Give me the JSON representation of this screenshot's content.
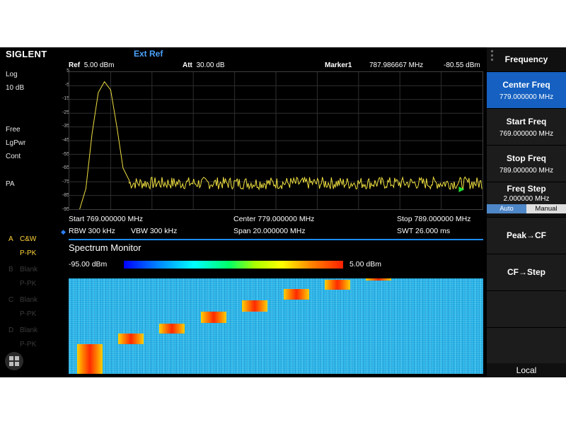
{
  "top": {
    "brand": "SIGLENT",
    "ext_ref": "Ext Ref"
  },
  "header": {
    "ref_label": "Ref",
    "ref_value": "5.00 dBm",
    "att_label": "Att",
    "att_value": "30.00 dB",
    "marker_label": "Marker1",
    "marker_freq": "787.986667 MHz",
    "marker_level": "-80.55 dBm"
  },
  "left_panel": {
    "scale_type": "Log",
    "scale_div": "10 dB",
    "trigger": "Free",
    "avg_type": "LgPwr",
    "sweep_mode": "Cont",
    "preamp": "PA",
    "traces": [
      {
        "letter": "A",
        "mode": "C&W",
        "detector": "P-PK",
        "active": true
      },
      {
        "letter": "B",
        "mode": "Blank",
        "detector": "P-PK",
        "active": false
      },
      {
        "letter": "C",
        "mode": "Blank",
        "detector": "P-PK",
        "active": false
      },
      {
        "letter": "D",
        "mode": "Blank",
        "detector": "P-PK",
        "active": false
      }
    ]
  },
  "yticks": [
    "5",
    "-5",
    "-15",
    "-25",
    "-35",
    "-45",
    "-55",
    "-65",
    "-75",
    "-85",
    "-95"
  ],
  "info": {
    "start": "Start  769.000000 MHz",
    "center": "Center  779.000000 MHz",
    "stop": "Stop  789.000000 MHz",
    "rbw": "RBW  300 kHz",
    "vbw": "VBW  300 kHz",
    "span": "Span    20.000000 MHz",
    "swt": "SWT  26.000 ms"
  },
  "spectrum_monitor": {
    "title": "Spectrum Monitor",
    "scale_min": "-95.00 dBm",
    "scale_max": "5.00 dBm"
  },
  "menu": {
    "title": "Frequency",
    "buttons": [
      {
        "label": "Center Freq",
        "value": "779.000000 MHz",
        "active": true
      },
      {
        "label": "Start Freq",
        "value": "769.000000 MHz",
        "active": false
      },
      {
        "label": "Stop Freq",
        "value": "789.000000 MHz",
        "active": false
      },
      {
        "label": "Freq Step",
        "value": "2.000000 MHz",
        "active": false
      },
      {
        "label": "Peak→CF",
        "value": "",
        "active": false
      },
      {
        "label": "CF→Step",
        "value": "",
        "active": false
      }
    ],
    "step_mode": {
      "auto": "Auto",
      "manual": "Manual",
      "selected": "Auto"
    },
    "local": "Local"
  },
  "colors": {
    "trace": "#f0e040",
    "marker": "#22dd33",
    "accent": "#1560c0",
    "divider": "#1e8cff"
  },
  "chart_data": {
    "type": "line",
    "title": "",
    "xlabel": "",
    "ylabel": "",
    "x_unit": "MHz",
    "y_unit": "dBm",
    "xlim": [
      769,
      789
    ],
    "ylim": [
      -95,
      5
    ],
    "series": [
      {
        "points": [
          [
            769.5,
            -95
          ],
          [
            769.8,
            -80
          ],
          [
            770.1,
            -40
          ],
          [
            770.4,
            -10
          ],
          [
            770.7,
            -2
          ],
          [
            771.0,
            -8
          ],
          [
            771.3,
            -35
          ],
          [
            771.6,
            -65
          ],
          [
            771.9,
            -74
          ],
          [
            772.5,
            -77
          ],
          [
            779,
            -76
          ],
          [
            789,
            -76
          ]
        ]
      }
    ],
    "marker": {
      "x": 787.986667,
      "y": -80.55
    },
    "grid": true
  }
}
